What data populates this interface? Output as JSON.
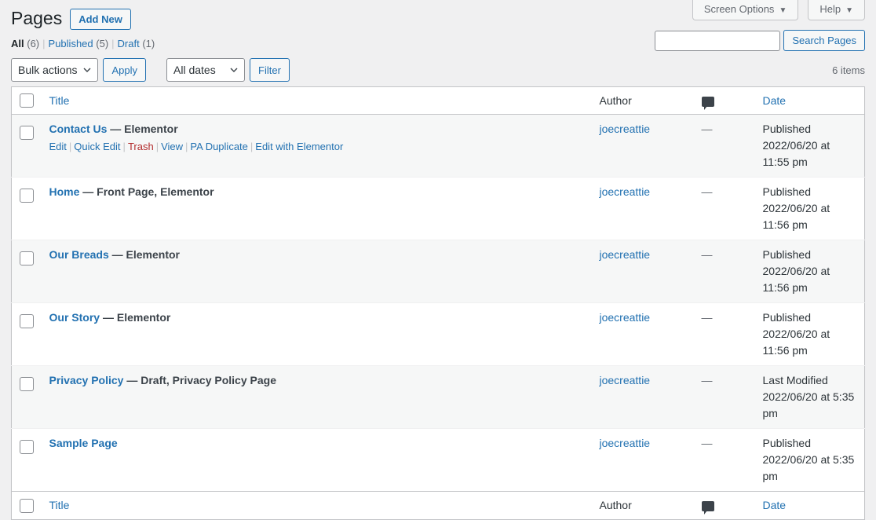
{
  "screen_meta": {
    "screen_options_label": "Screen Options",
    "help_label": "Help",
    "caret": "▼"
  },
  "header": {
    "page_title": "Pages",
    "add_new_label": "Add New"
  },
  "status_filters": {
    "items": [
      {
        "label": "All",
        "count": "(6)",
        "current": true
      },
      {
        "label": "Published",
        "count": "(5)",
        "current": false
      },
      {
        "label": "Draft",
        "count": "(1)",
        "current": false
      }
    ],
    "separator": "|"
  },
  "search": {
    "value": "",
    "placeholder": "",
    "button_label": "Search Pages"
  },
  "tablenav": {
    "bulk_actions_selected": "Bulk actions",
    "apply_label": "Apply",
    "dates_selected": "All dates",
    "filter_label": "Filter",
    "displaying_num": "6 items"
  },
  "table": {
    "columns": {
      "title": "Title",
      "author": "Author",
      "comments_icon": "comment-bubble-icon",
      "date": "Date"
    },
    "rows": [
      {
        "title": "Contact Us",
        "state": "— Elementor",
        "author": "joecreattie",
        "comments": "—",
        "date_status": "Published",
        "date_value": "2022/06/20 at 11:55 pm",
        "actions": [
          {
            "label": "Edit",
            "kind": "link"
          },
          {
            "label": "Quick Edit",
            "kind": "link"
          },
          {
            "label": "Trash",
            "kind": "trash"
          },
          {
            "label": "View",
            "kind": "link"
          },
          {
            "label": "PA Duplicate",
            "kind": "link"
          },
          {
            "label": "Edit with Elementor",
            "kind": "link"
          }
        ]
      },
      {
        "title": "Home",
        "state": "— Front Page, Elementor",
        "author": "joecreattie",
        "comments": "—",
        "date_status": "Published",
        "date_value": "2022/06/20 at 11:56 pm",
        "actions": []
      },
      {
        "title": "Our Breads",
        "state": "— Elementor",
        "author": "joecreattie",
        "comments": "—",
        "date_status": "Published",
        "date_value": "2022/06/20 at 11:56 pm",
        "actions": []
      },
      {
        "title": "Our Story",
        "state": "— Elementor",
        "author": "joecreattie",
        "comments": "—",
        "date_status": "Published",
        "date_value": "2022/06/20 at 11:56 pm",
        "actions": []
      },
      {
        "title": "Privacy Policy",
        "state": "— Draft, Privacy Policy Page",
        "author": "joecreattie",
        "comments": "—",
        "date_status": "Last Modified",
        "date_value": "2022/06/20 at 5:35 pm",
        "actions": []
      },
      {
        "title": "Sample Page",
        "state": "",
        "author": "joecreattie",
        "comments": "—",
        "date_status": "Published",
        "date_value": "2022/06/20 at 5:35 pm",
        "actions": []
      }
    ]
  },
  "colors": {
    "link": "#2271b1",
    "trash": "#b32d2e",
    "background": "#f0f0f1",
    "alt_row": "#f6f7f7",
    "text": "#3c434a"
  }
}
